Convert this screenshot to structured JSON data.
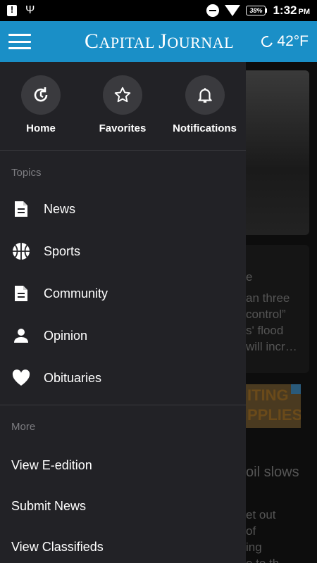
{
  "status_bar": {
    "battery": "38%",
    "time": "1:32",
    "ampm": "PM"
  },
  "header": {
    "logo": "Capital Journal",
    "temperature": "42°F"
  },
  "quick_links": [
    {
      "label": "Home",
      "icon": "home-refresh-icon"
    },
    {
      "label": "Favorites",
      "icon": "star-icon"
    },
    {
      "label": "Notifications",
      "icon": "bell-icon"
    }
  ],
  "topics": {
    "title": "Topics",
    "items": [
      {
        "label": "News",
        "icon": "document-icon"
      },
      {
        "label": "Sports",
        "icon": "basketball-icon"
      },
      {
        "label": "Community",
        "icon": "document-icon"
      },
      {
        "label": "Opinion",
        "icon": "person-icon"
      },
      {
        "label": "Obituaries",
        "icon": "heart-icon"
      }
    ]
  },
  "more": {
    "title": "More",
    "items": [
      {
        "label": "View E-edition"
      },
      {
        "label": "Submit News"
      },
      {
        "label": "View Classifieds"
      }
    ]
  },
  "background": {
    "snippet_lines": [
      "e",
      "an three",
      " control”",
      "s' flood",
      "will incr…"
    ],
    "ad_text": [
      "ITING",
      "PPLIES"
    ],
    "headline2": "oil slows",
    "snippet2_lines": [
      "et out",
      "of",
      "ing",
      "e to th"
    ]
  },
  "colors": {
    "header": "#1a8fc7",
    "drawer": "#222226",
    "icon_circle": "#3a3a3e"
  }
}
